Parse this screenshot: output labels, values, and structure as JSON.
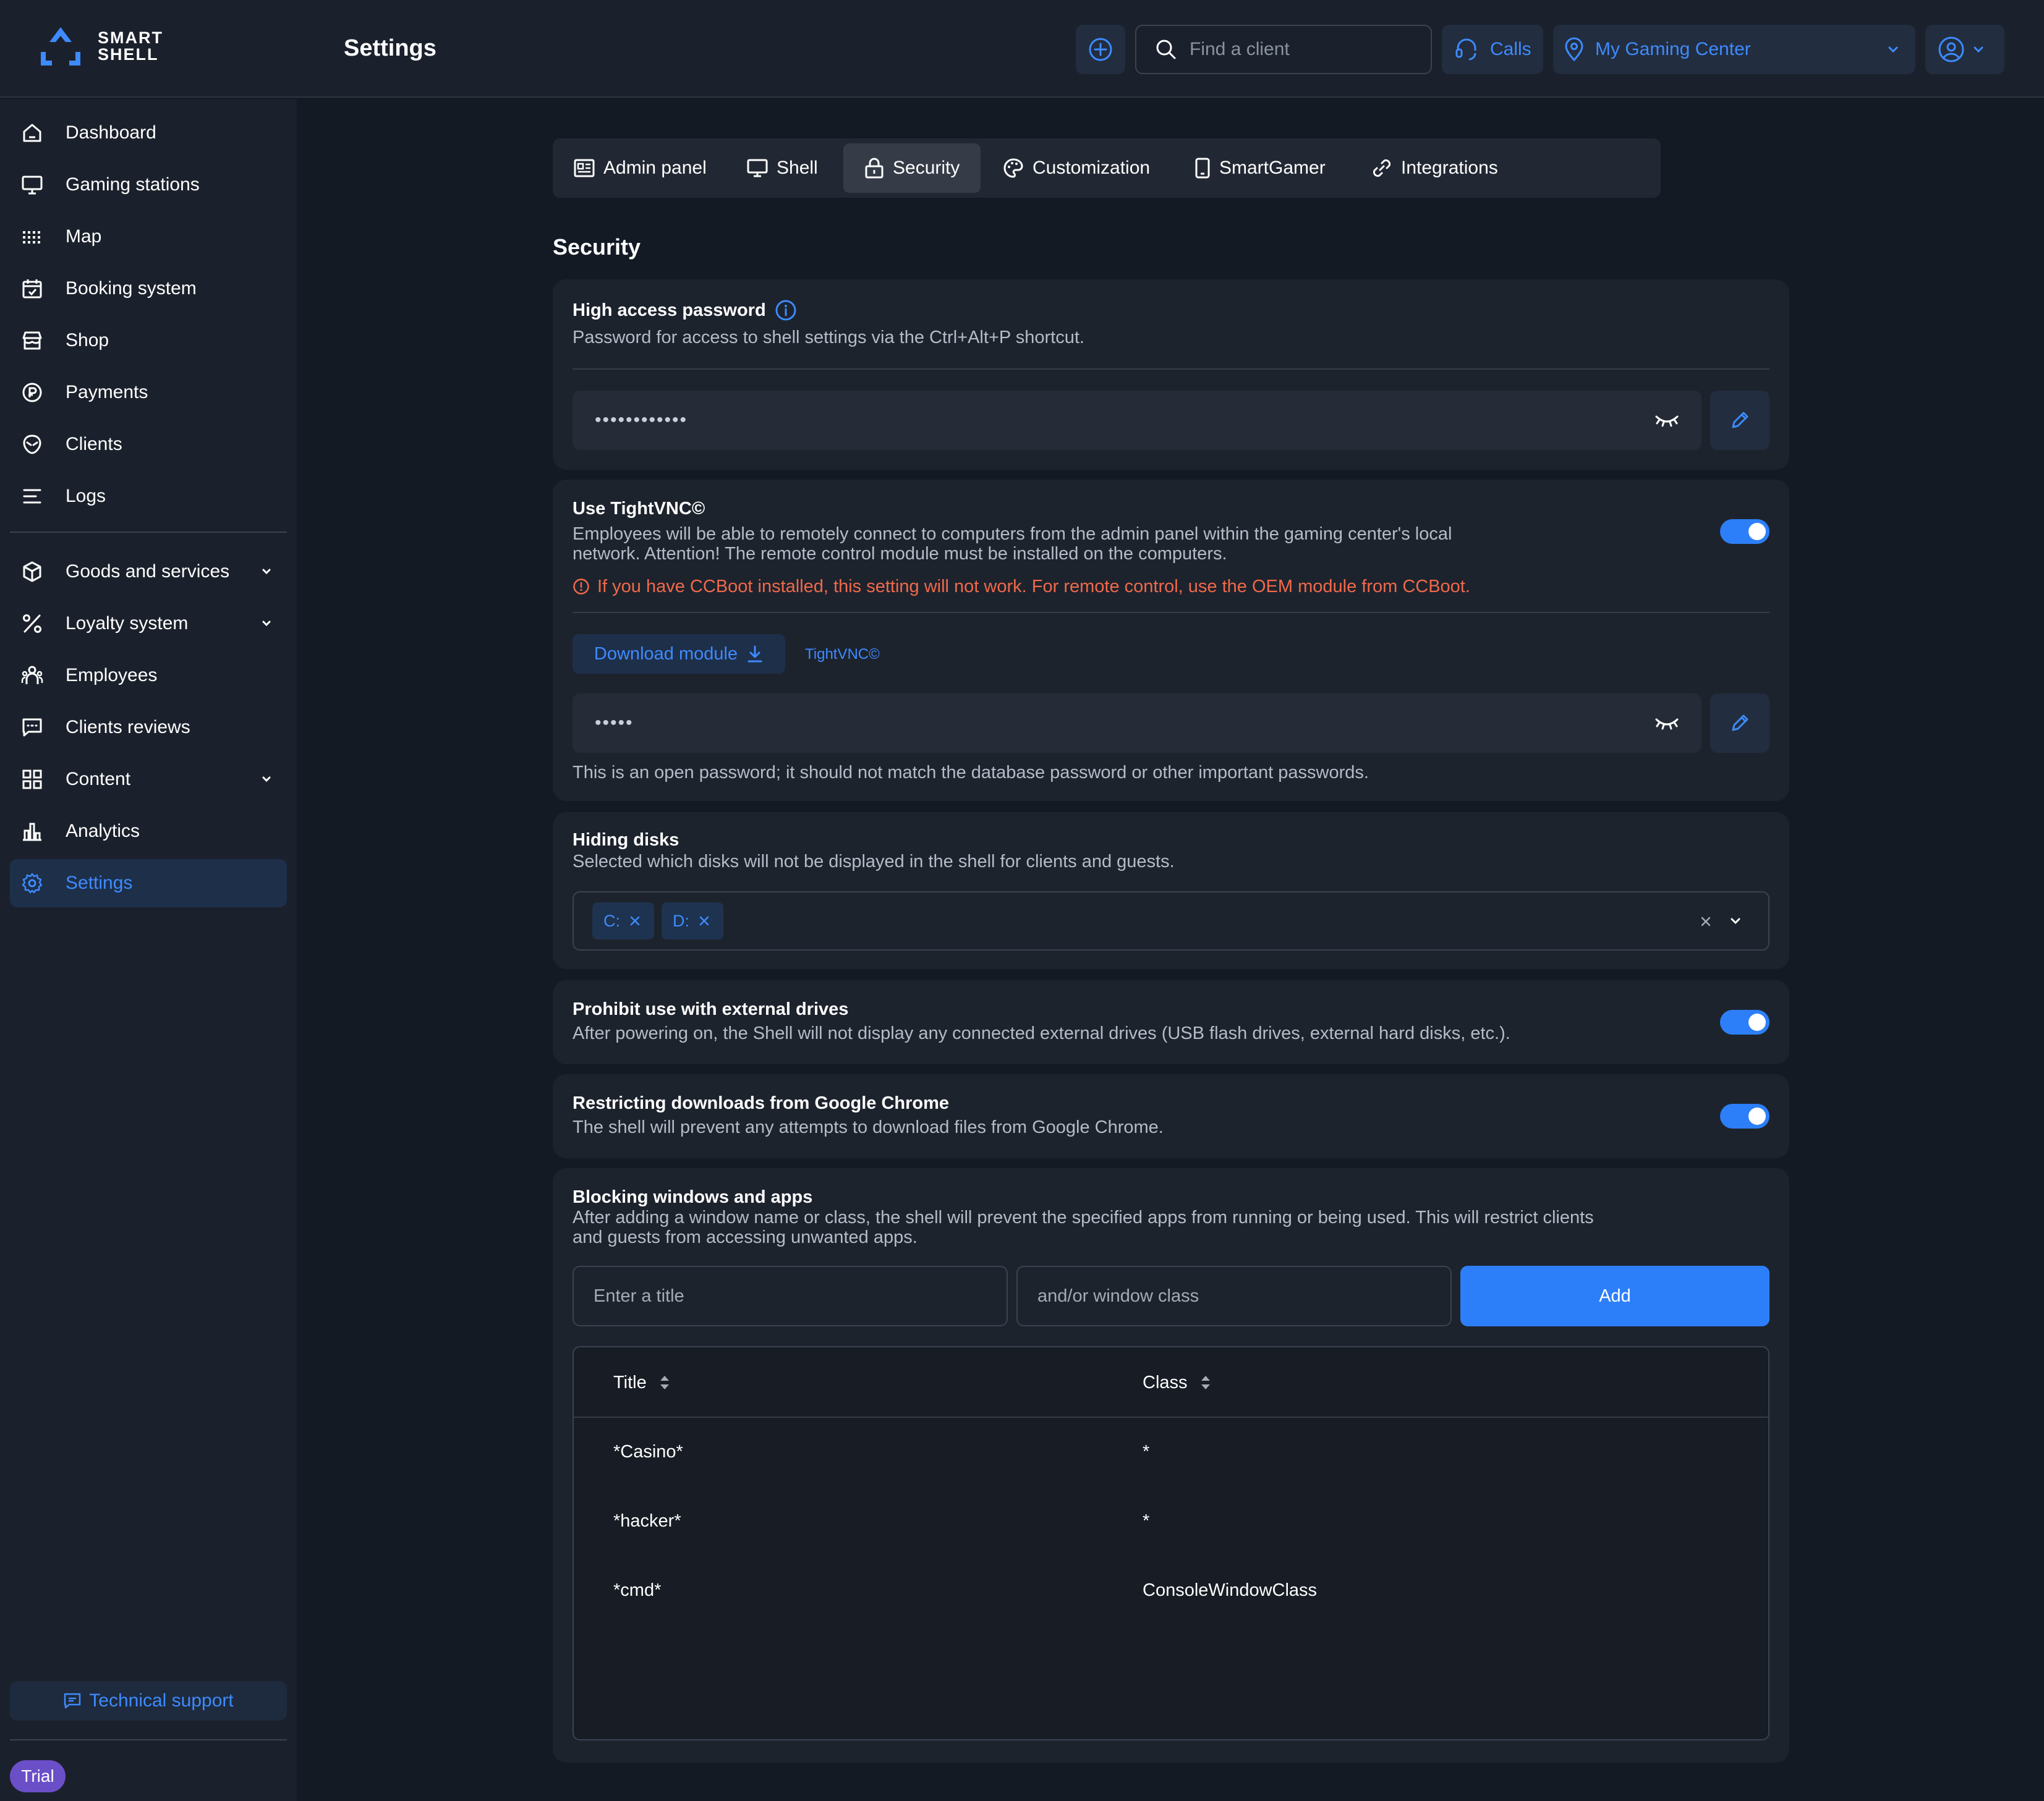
{
  "app": {
    "logo_line1": "SMART",
    "logo_line2": "SHELL",
    "page_title": "Settings"
  },
  "header": {
    "search_placeholder": "Find a client",
    "calls_label": "Calls",
    "location_label": "My Gaming Center"
  },
  "sidebar": {
    "items": [
      {
        "label": "Dashboard",
        "icon": "home-icon"
      },
      {
        "label": "Gaming stations",
        "icon": "monitor-icon"
      },
      {
        "label": "Map",
        "icon": "grid-dots-icon"
      },
      {
        "label": "Booking system",
        "icon": "calendar-icon"
      },
      {
        "label": "Shop",
        "icon": "store-icon"
      },
      {
        "label": "Payments",
        "icon": "payment-icon"
      },
      {
        "label": "Clients",
        "icon": "alien-icon"
      },
      {
        "label": "Logs",
        "icon": "list-icon"
      },
      {
        "label": "Goods and services",
        "icon": "box-icon"
      },
      {
        "label": "Loyalty system",
        "icon": "percent-icon"
      },
      {
        "label": "Employees",
        "icon": "people-icon"
      },
      {
        "label": "Clients reviews",
        "icon": "chat-icon"
      },
      {
        "label": "Content",
        "icon": "layout-icon"
      },
      {
        "label": "Analytics",
        "icon": "bar-chart-icon"
      },
      {
        "label": "Settings",
        "icon": "gear-icon"
      }
    ],
    "support_label": "Technical support",
    "trial_label": "Trial"
  },
  "tabs": [
    {
      "label": "Admin panel",
      "icon": "admin-panel-icon"
    },
    {
      "label": "Shell",
      "icon": "monitor-icon"
    },
    {
      "label": "Security",
      "icon": "lock-icon"
    },
    {
      "label": "Customization",
      "icon": "palette-icon"
    },
    {
      "label": "SmartGamer",
      "icon": "phone-icon"
    },
    {
      "label": "Integrations",
      "icon": "link-icon"
    }
  ],
  "security": {
    "section_title": "Security",
    "high_access": {
      "title": "High access password",
      "description": "Password for access to shell settings via the Ctrl+Alt+P shortcut.",
      "masked_value": "••••••••••••"
    },
    "tightvnc": {
      "title": "Use TightVNC©",
      "description_line1": "Employees will be able to remotely connect to computers from the admin panel within the gaming center's local",
      "description_line2": "network. Attention! The remote control module must be installed on the computers.",
      "warning": "If you have CCBoot installed, this setting will not work. For remote control, use the OEM module from CCBoot.",
      "download_label": "Download module",
      "link_label": "TightVNC©",
      "masked_value": "•••••",
      "hint": "This is an open password; it should not match the database password or other important passwords."
    },
    "hiding_disks": {
      "title": "Hiding disks",
      "description": "Selected which disks will not be displayed in the shell for clients and guests.",
      "tags": [
        "C:",
        "D:"
      ]
    },
    "external_drives": {
      "title": "Prohibit use with external drives",
      "description": "After powering on, the Shell will not display any connected external drives (USB flash drives, external hard disks, etc.)."
    },
    "chrome_downloads": {
      "title": "Restricting downloads from Google Chrome",
      "description": "The shell will prevent any attempts to download files from Google Chrome."
    },
    "blocking": {
      "title": "Blocking windows and apps",
      "description_line1": "After adding a window name or class, the shell will prevent the specified apps from running or being used. This will restrict clients",
      "description_line2": "and guests from accessing unwanted apps.",
      "title_placeholder": "Enter a title",
      "class_placeholder": "and/or window class",
      "add_label": "Add",
      "columns": [
        "Title",
        "Class"
      ],
      "rows": [
        {
          "title": "*Casino*",
          "class": "*"
        },
        {
          "title": "*hacker*",
          "class": "*"
        },
        {
          "title": "*cmd*",
          "class": "ConsoleWindowClass"
        }
      ]
    }
  },
  "colors": {
    "accent": "#2d7ff9",
    "link": "#3d8bff",
    "warning": "#f0694a",
    "background": "#141a24",
    "card": "#1d232d",
    "trial_badge": "#6b4fc8"
  }
}
